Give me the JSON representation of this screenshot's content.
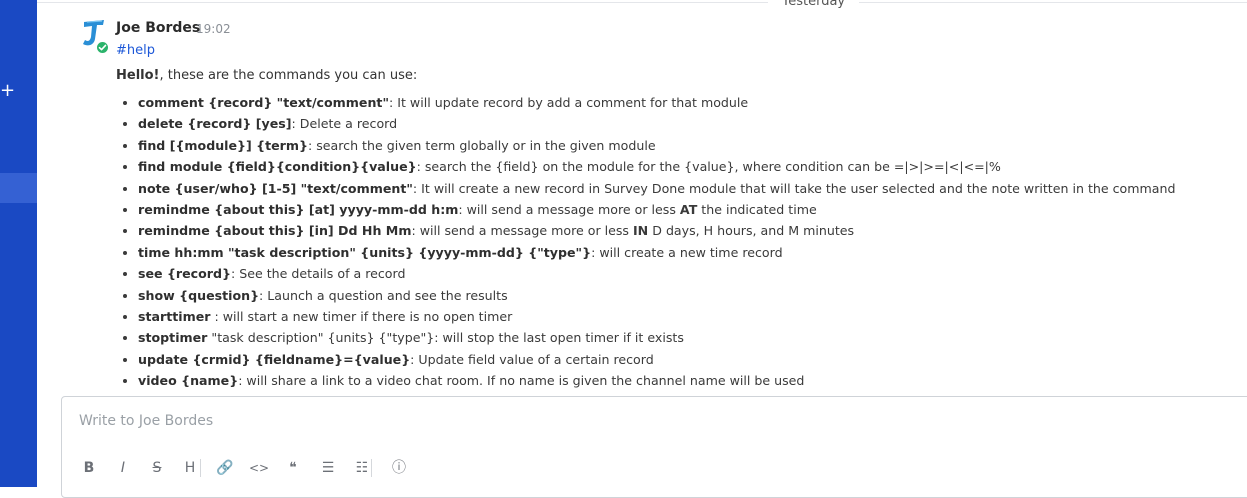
{
  "sidebar": {
    "plus_icon": "+"
  },
  "divider": {
    "label": "Yesterday"
  },
  "message": {
    "author": "Joe Bordes",
    "time": "19:02",
    "channel": "#help",
    "intro_bold": "Hello!",
    "intro_rest": ", these are the commands you can use:",
    "avatar_letter": "J",
    "status_color": "#2bb36b"
  },
  "commands": [
    {
      "cmd": "comment {record} \"text/comment\"",
      "desc": ": It will update record by add a comment for that module"
    },
    {
      "cmd": "delete {record} [yes]",
      "desc": ": Delete a record"
    },
    {
      "cmd": "find [{module}] {term}",
      "desc": ": search the given term globally or in the given module"
    },
    {
      "cmd": "find module {field}{condition}{value}",
      "desc": ": search the {field} on the module for the {value}, where condition can be =|>|>=|<|<=|%"
    },
    {
      "cmd": "note {user/who} [1-5] \"text/comment\"",
      "desc": ": It will create a new record in Survey Done module that will take the user selected and the note written in the command"
    },
    {
      "cmd": "remindme {about this} [at] yyyy-mm-dd h:m",
      "desc": ": will send a message more or less ",
      "em": "AT",
      "desc2": " the indicated time"
    },
    {
      "cmd": "remindme {about this} [in] Dd Hh Mm",
      "desc": ": will send a message more or less ",
      "em": "IN",
      "desc2": " D days, H hours, and M minutes"
    },
    {
      "cmd": "time hh:mm \"task description\" {units} {yyyy-mm-dd} {\"type\"}",
      "desc": ": will create a new time record"
    },
    {
      "cmd": "see {record}",
      "desc": ": See the details of a record"
    },
    {
      "cmd": "show {question}",
      "desc": ": Launch a question and see the results"
    },
    {
      "cmd": "starttimer",
      "desc": " : will start a new timer if there is no open timer"
    },
    {
      "cmd": "stoptimer",
      "desc": " \"task description\" {units} {\"type\"}: will stop the last open timer if it exists"
    },
    {
      "cmd": "update {crmid} {fieldname}={value}",
      "desc": ": Update field value of a certain record"
    },
    {
      "cmd": "video {name}",
      "desc": ": will share a link to a video chat room. If no name is given the channel name will be used"
    }
  ],
  "composer": {
    "placeholder": "Write to Joe Bordes",
    "tools": [
      {
        "name": "bold-icon",
        "glyph": "B"
      },
      {
        "name": "italic-icon",
        "glyph": "I"
      },
      {
        "name": "strikethrough-icon",
        "glyph": "S"
      },
      {
        "name": "heading-icon",
        "glyph": "H"
      },
      {
        "name": "link-icon",
        "glyph": "🔗"
      },
      {
        "name": "code-icon",
        "glyph": "<>"
      },
      {
        "name": "quote-icon",
        "glyph": "❝"
      },
      {
        "name": "bullet-list-icon",
        "glyph": "☰"
      },
      {
        "name": "numbered-list-icon",
        "glyph": "☷"
      },
      {
        "name": "info-icon",
        "glyph": "ⓘ"
      }
    ]
  }
}
